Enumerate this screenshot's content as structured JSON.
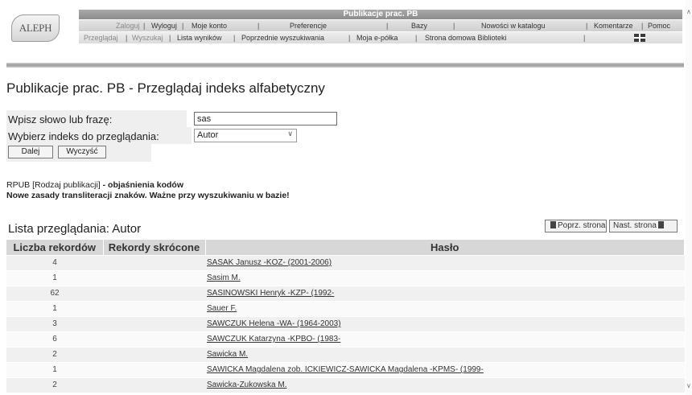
{
  "header": {
    "logo": "ALEPH",
    "title": "Publikacje prac. PB",
    "menu_row1": [
      "Zaloguj",
      "Wyloguj",
      "Moje konto",
      "Preferencje",
      "Bazy",
      "Nowości w katalogu",
      "Komentarze",
      "Pomoc"
    ],
    "menu_row2": [
      "Przeglądaj",
      "Wyszukaj",
      "Lista wyników",
      "Poprzednie wyszukiwania",
      "Moja e-półka",
      "Strona domowa Biblioteki"
    ]
  },
  "page_title": "Publikacje prac. PB - Przeglądaj indeks alfabetyczny",
  "form": {
    "term_label": "Wpisz słowo lub frazę:",
    "term_value": "sas",
    "index_label": "Wybierz indeks do przeglądania:",
    "index_value": "Autor",
    "next_button": "Dalej",
    "clear_button": "Wyczyść"
  },
  "notes": {
    "line1_prefix": "RPUB [Rodzaj publikacji]",
    "line1_suffix": " - objaśnienia kodów",
    "line2": "Nowe zasady transliteracji znaków. Ważne przy wyszukiwaniu w bazie!"
  },
  "list": {
    "title": "Lista przeglądania: Autor",
    "prev_page": "Poprz. strona",
    "next_page": "Nast. strona",
    "columns": [
      "Liczba rekordów",
      "Rekordy skrócone",
      "Hasło"
    ],
    "rows": [
      {
        "count": "4",
        "short": "",
        "heslo": "SASAK Janusz -KOZ- (2001-2006)"
      },
      {
        "count": "1",
        "short": "",
        "heslo": "Sasim M."
      },
      {
        "count": "62",
        "short": "",
        "heslo": "SASINOWSKI Henryk -KZP- (1992-"
      },
      {
        "count": "1",
        "short": "",
        "heslo": "Sauer F."
      },
      {
        "count": "3",
        "short": "",
        "heslo": "SAWCZUK Helena -WA- (1964-2003)"
      },
      {
        "count": "6",
        "short": "",
        "heslo": "SAWCZUK Katarzyna -KPBO- (1983-"
      },
      {
        "count": "2",
        "short": "",
        "heslo": "Sawicka M."
      },
      {
        "count": "1",
        "short": "",
        "heslo": "SAWICKA Magdalena zob. ICKIEWICZ-SAWICKA Magdalena -KPMS- (1999-"
      },
      {
        "count": "2",
        "short": "",
        "heslo": "Sawicka-Zukowska M."
      }
    ]
  }
}
